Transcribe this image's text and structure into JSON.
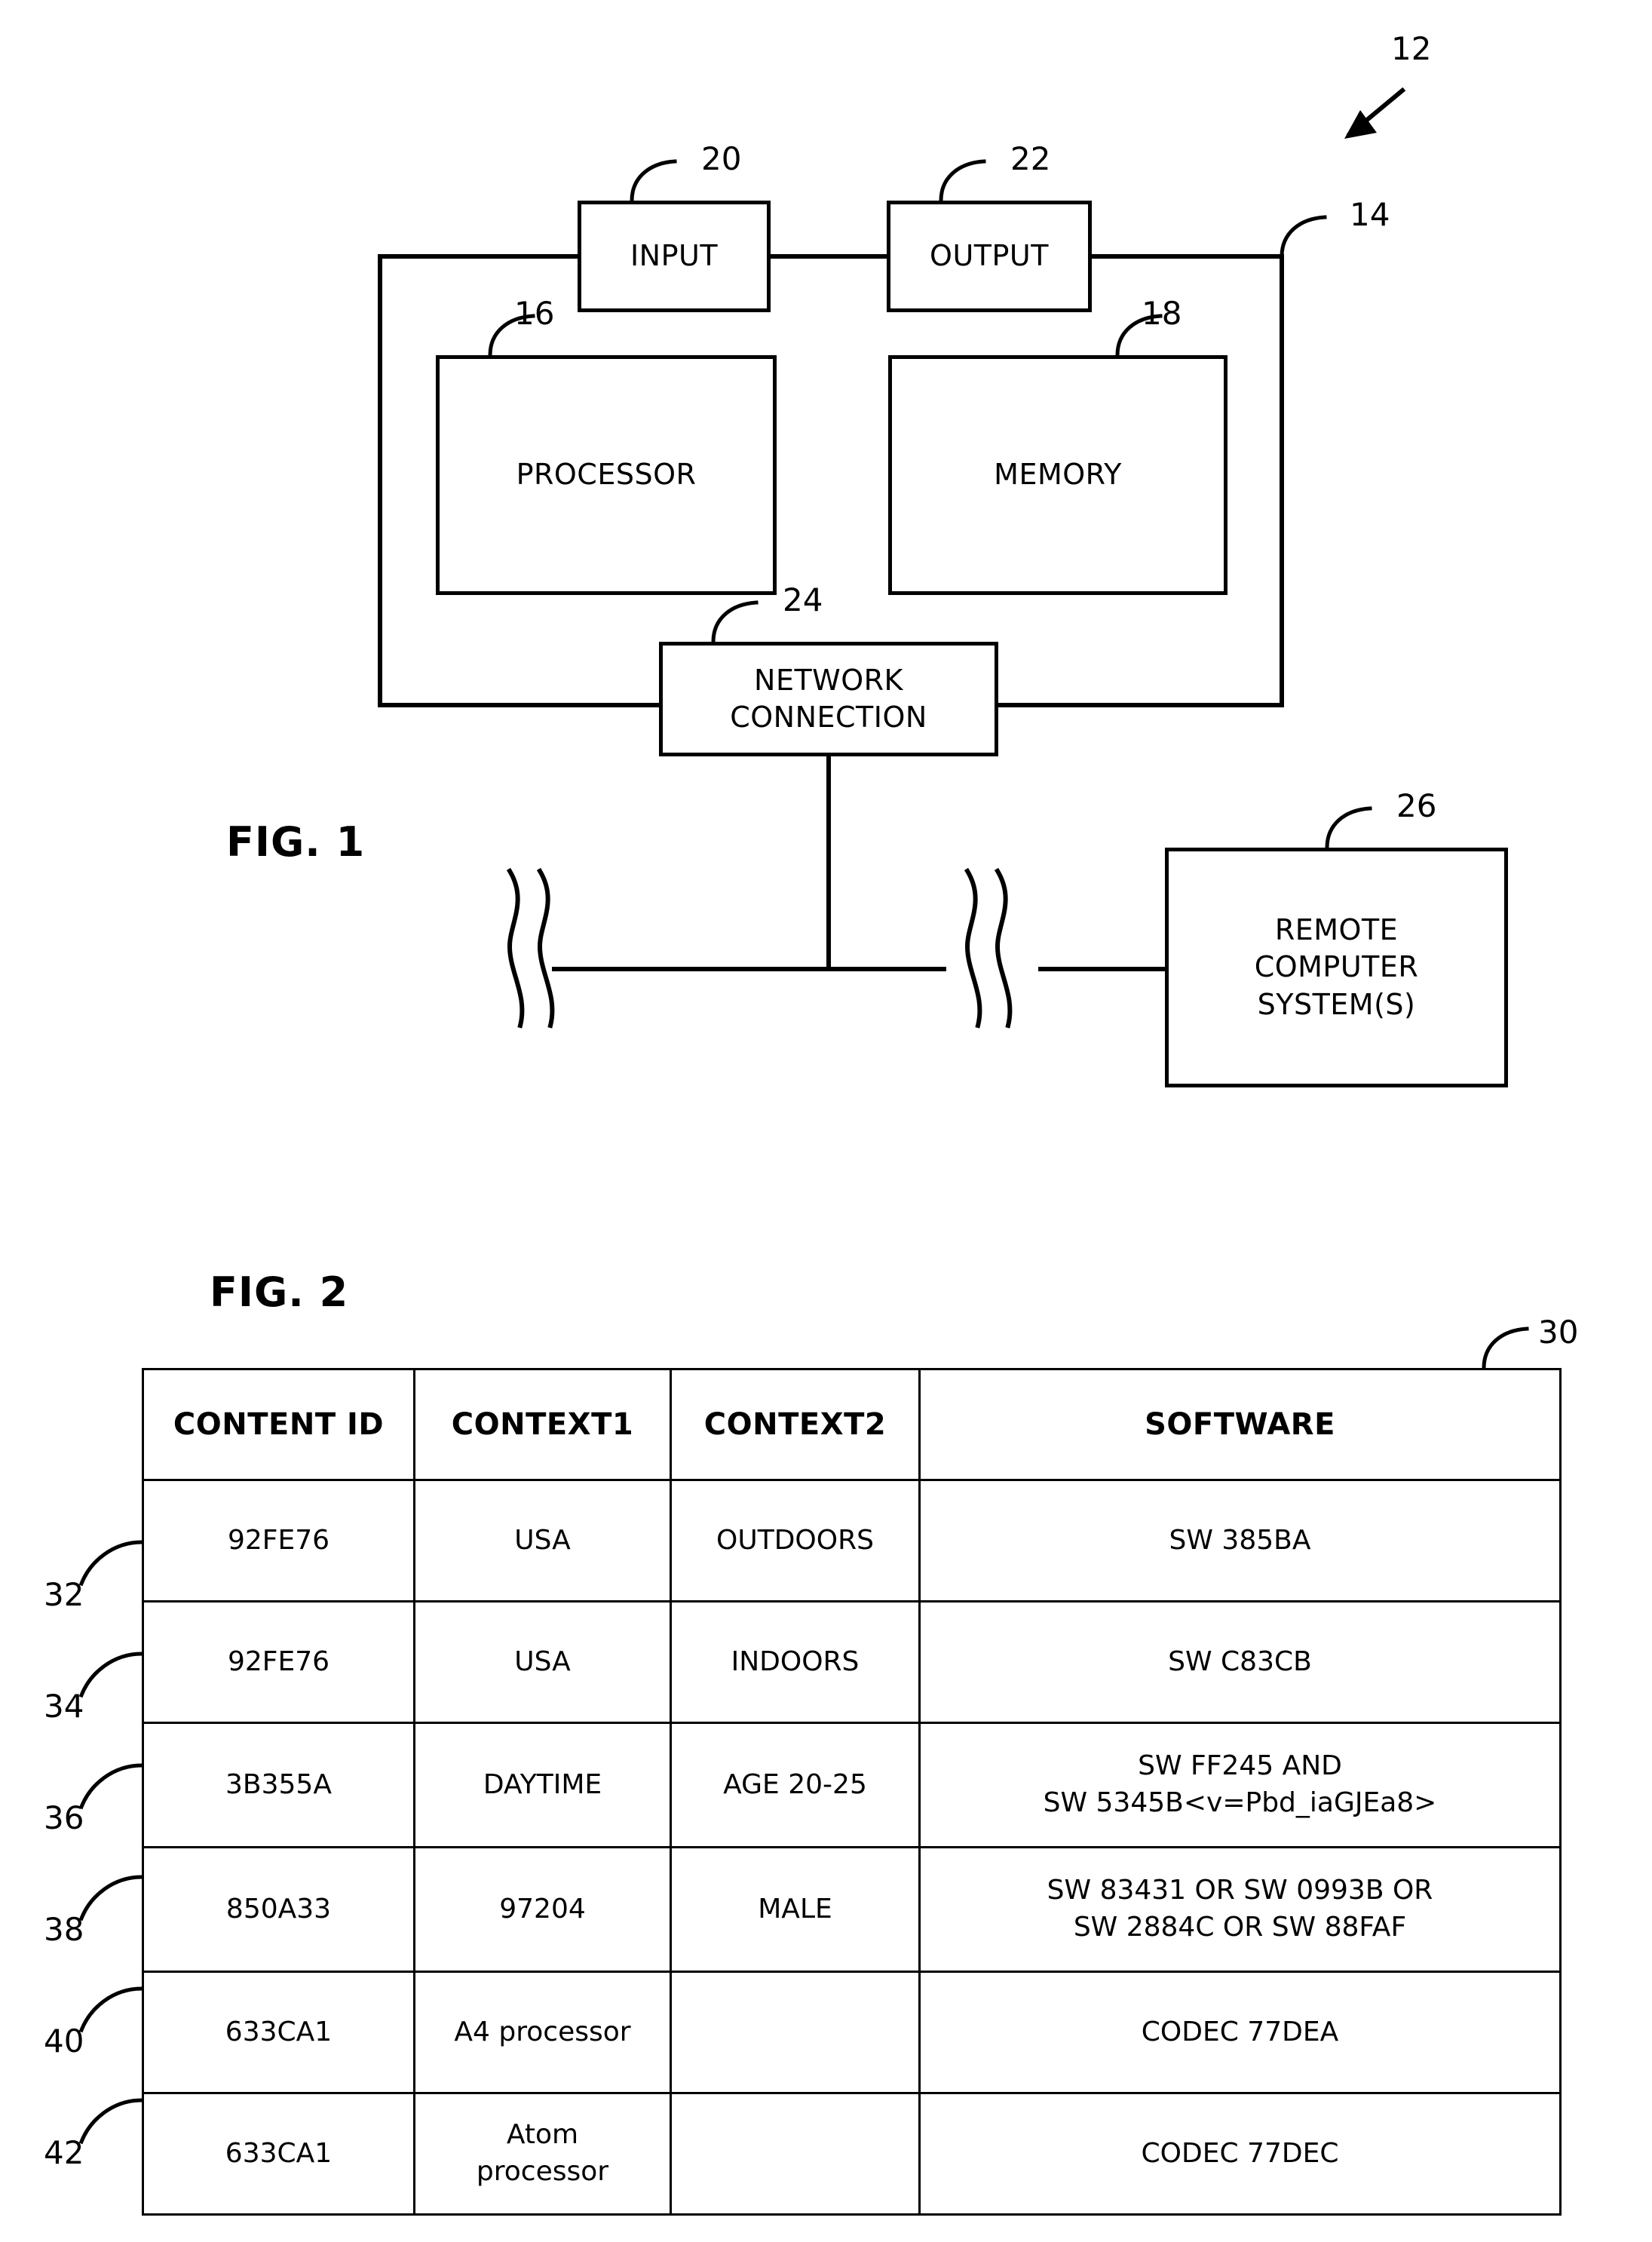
{
  "figure1": {
    "title": "FIG. 1",
    "system_ref": "12",
    "computer_ref": "14",
    "boxes": [
      {
        "key": "input",
        "label": "INPUT",
        "ref": "20"
      },
      {
        "key": "output",
        "label": "OUTPUT",
        "ref": "22"
      },
      {
        "key": "processor",
        "label": "PROCESSOR",
        "ref": "16"
      },
      {
        "key": "memory",
        "label": "MEMORY",
        "ref": "18"
      },
      {
        "key": "network",
        "label_line1": "NETWORK",
        "label_line2": "CONNECTION",
        "ref": "24"
      },
      {
        "key": "remote",
        "label_line1": "REMOTE",
        "label_line2": "COMPUTER",
        "label_line3": "SYSTEM(S)",
        "ref": "26"
      }
    ],
    "input_label": "INPUT",
    "output_label": "OUTPUT",
    "processor_label": "PROCESSOR",
    "memory_label": "MEMORY",
    "network_line1": "NETWORK",
    "network_line2": "CONNECTION",
    "remote_line1": "REMOTE",
    "remote_line2": "COMPUTER",
    "remote_line3": "SYSTEM(S)",
    "ref_20": "20",
    "ref_22": "22",
    "ref_16": "16",
    "ref_18": "18",
    "ref_24": "24",
    "ref_26": "26",
    "ref_14": "14",
    "ref_12": "12"
  },
  "figure2": {
    "title": "FIG. 2",
    "table_ref": "30",
    "row_refs": [
      "32",
      "34",
      "36",
      "38",
      "40",
      "42"
    ],
    "table": {
      "headers": [
        "CONTENT ID",
        "CONTEXT1",
        "CONTEXT2",
        "SOFTWARE"
      ],
      "rows": [
        {
          "ref": "32",
          "content_id": "92FE76",
          "context1": "USA",
          "context2": "OUTDOORS",
          "software_lines": [
            "SW 385BA"
          ]
        },
        {
          "ref": "34",
          "content_id": "92FE76",
          "context1": "USA",
          "context2": "INDOORS",
          "software_lines": [
            "SW C83CB"
          ]
        },
        {
          "ref": "36",
          "content_id": "3B355A",
          "context1": "DAYTIME",
          "context2": "AGE 20-25",
          "software_lines": [
            "SW FF245 AND",
            "SW 5345B<v=Pbd_iaGJEa8>"
          ]
        },
        {
          "ref": "38",
          "content_id": "850A33",
          "context1": "97204",
          "context2": "MALE",
          "software_lines": [
            "SW 83431 OR SW 0993B OR",
            "SW 2884C OR SW 88FAF"
          ]
        },
        {
          "ref": "40",
          "content_id": "633CA1",
          "context1": "A4 processor",
          "context2": "",
          "software_lines": [
            "CODEC 77DEA"
          ]
        },
        {
          "ref": "42",
          "content_id": "633CA1",
          "context1": "Atom processor",
          "context2": "",
          "software_lines": [
            "CODEC 77DEC"
          ]
        }
      ]
    },
    "cells": {
      "h0": "CONTENT ID",
      "h1": "CONTEXT1",
      "h2": "CONTEXT2",
      "h3": "SOFTWARE",
      "r0c0": "92FE76",
      "r0c1": "USA",
      "r0c2": "OUTDOORS",
      "r0c3": "SW 385BA",
      "r1c0": "92FE76",
      "r1c1": "USA",
      "r1c2": "INDOORS",
      "r1c3": "SW C83CB",
      "r2c0": "3B355A",
      "r2c1": "DAYTIME",
      "r2c2": "AGE 20-25",
      "r2c3a": "SW FF245 AND",
      "r2c3b": "SW 5345B<v=Pbd_iaGJEa8>",
      "r3c0": "850A33",
      "r3c1": "97204",
      "r3c2": "MALE",
      "r3c3a": "SW 83431 OR SW 0993B OR",
      "r3c3b": "SW 2884C OR SW 88FAF",
      "r4c0": "633CA1",
      "r4c1": "A4 processor",
      "r4c2": "",
      "r4c3": "CODEC 77DEA",
      "r5c0": "633CA1",
      "r5c1a": "Atom",
      "r5c1b": "processor",
      "r5c2": "",
      "r5c3": "CODEC 77DEC"
    }
  },
  "colors": {
    "ink": "#000000",
    "paper": "#ffffff"
  }
}
